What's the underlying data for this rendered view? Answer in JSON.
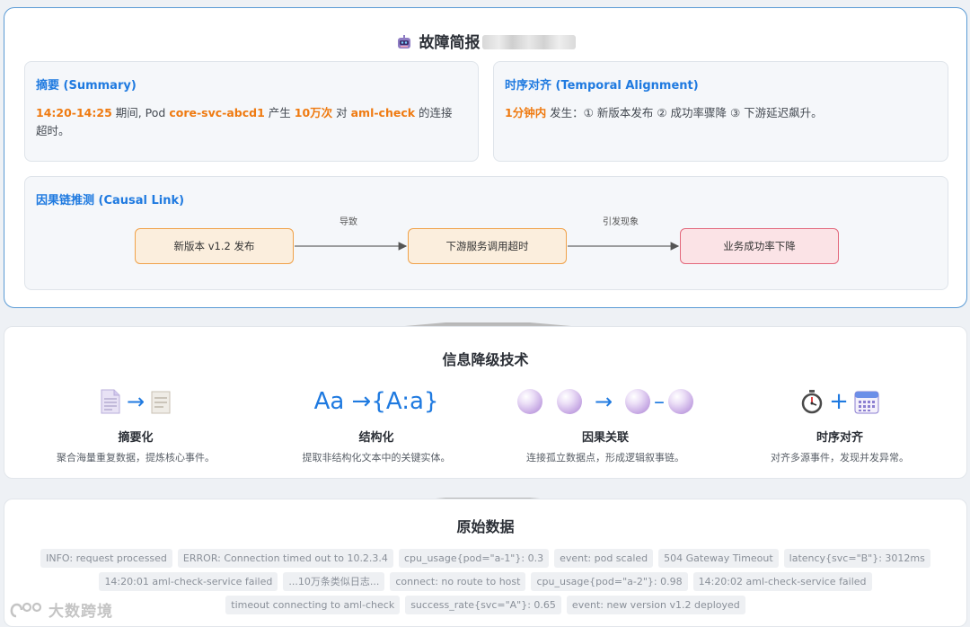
{
  "report": {
    "title": "故障简报",
    "summary": {
      "heading": "摘要 (Summary)",
      "time_range": "14:20-14:25",
      "text_1": " 期间, Pod ",
      "pod": "core-svc-abcd1",
      "text_2": " 产生 ",
      "count": "10万次",
      "text_3": " 对 ",
      "target": "aml-check",
      "text_4": " 的连接超时。"
    },
    "temporal": {
      "heading": "时序对齐 (Temporal Alignment)",
      "window": "1分钟内",
      "text": " 发生：① 新版本发布 ② 成功率骤降 ③ 下游延迟飙升。"
    },
    "causal": {
      "heading": "因果链推测 (Causal Link)",
      "nodes": [
        "新版本 v1.2 发布",
        "下游服务调用超时",
        "业务成功率下降"
      ],
      "edges": [
        "导致",
        "引发现象"
      ]
    }
  },
  "techniques": {
    "title": "信息降级技术",
    "items": [
      {
        "name": "摘要化",
        "desc": "聚合海量重复数据，提炼核心事件。"
      },
      {
        "name": "结构化",
        "desc": "提取非结构化文本中的关键实体。",
        "visual_text": "Aa →{A:a}"
      },
      {
        "name": "因果关联",
        "desc": "连接孤立数据点，形成逻辑叙事链。"
      },
      {
        "name": "时序对齐",
        "desc": "对齐多源事件，发现并发异常。"
      }
    ],
    "icons": [
      "document-icon",
      "arrow-right-icon",
      "short-document-icon",
      "sphere-icon",
      "stopwatch-icon",
      "plus-icon",
      "calendar-icon"
    ]
  },
  "raw": {
    "title": "原始数据",
    "rows": [
      [
        "INFO: request processed",
        "ERROR: Connection timed out to 10.2.3.4",
        "cpu_usage{pod=\"a-1\"}: 0.3",
        "event: pod scaled",
        "504 Gateway Timeout",
        "latency{svc=\"B\"}: 3012ms"
      ],
      [
        "14:20:01 aml-check-service failed",
        "...10万条类似日志...",
        "connect: no route to host",
        "cpu_usage{pod=\"a-2\"}: 0.98",
        "14:20:02 aml-check-service failed"
      ],
      [
        "timeout connecting to aml-check",
        "success_rate{svc=\"A\"}: 0.65",
        "event: new version v1.2 deployed"
      ]
    ]
  },
  "watermark": "大数跨境",
  "colors": {
    "accent": "#1f7ae0",
    "highlight": "#ef7a10",
    "border_blue": "#5b9bd5",
    "node_orange": "#f0a24a",
    "node_red": "#e3687c"
  }
}
